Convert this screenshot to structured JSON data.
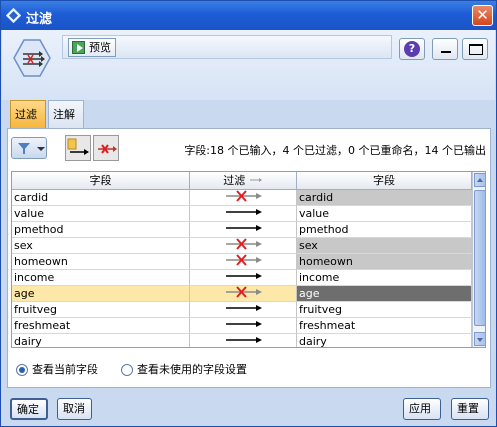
{
  "window": {
    "title": "过滤",
    "close_glyph": "✕"
  },
  "header": {
    "preview_label": "预览",
    "help_glyph": "?"
  },
  "tabs": [
    {
      "label": "过滤",
      "active": true
    },
    {
      "label": "注解",
      "active": false
    }
  ],
  "status": {
    "text": "字段:18 个已输入，4 个已过滤，0 个已重命名，14 个已输出"
  },
  "table": {
    "columns": [
      "字段",
      "过滤",
      "字段"
    ],
    "rows": [
      {
        "input": "cardid",
        "filtered": true,
        "output": "cardid",
        "selected": false
      },
      {
        "input": "value",
        "filtered": false,
        "output": "value",
        "selected": false
      },
      {
        "input": "pmethod",
        "filtered": false,
        "output": "pmethod",
        "selected": false
      },
      {
        "input": "sex",
        "filtered": true,
        "output": "sex",
        "selected": false
      },
      {
        "input": "homeown",
        "filtered": true,
        "output": "homeown",
        "selected": false
      },
      {
        "input": "income",
        "filtered": false,
        "output": "income",
        "selected": false
      },
      {
        "input": "age",
        "filtered": true,
        "output": "age",
        "selected": true
      },
      {
        "input": "fruitveg",
        "filtered": false,
        "output": "fruitveg",
        "selected": false
      },
      {
        "input": "freshmeat",
        "filtered": false,
        "output": "freshmeat",
        "selected": false
      },
      {
        "input": "dairy",
        "filtered": false,
        "output": "dairy",
        "selected": false
      }
    ]
  },
  "radios": [
    {
      "label": "查看当前字段",
      "checked": true
    },
    {
      "label": "查看未使用的字段设置",
      "checked": false
    }
  ],
  "footer": {
    "ok": "确定",
    "cancel": "取消",
    "apply": "应用",
    "reset": "重置"
  },
  "colors": {
    "titlebar": "#1d5cd6",
    "selected_row": "#fde7a9",
    "filtered_cell": "#c8c8c8",
    "filter_x": "#e02020"
  }
}
